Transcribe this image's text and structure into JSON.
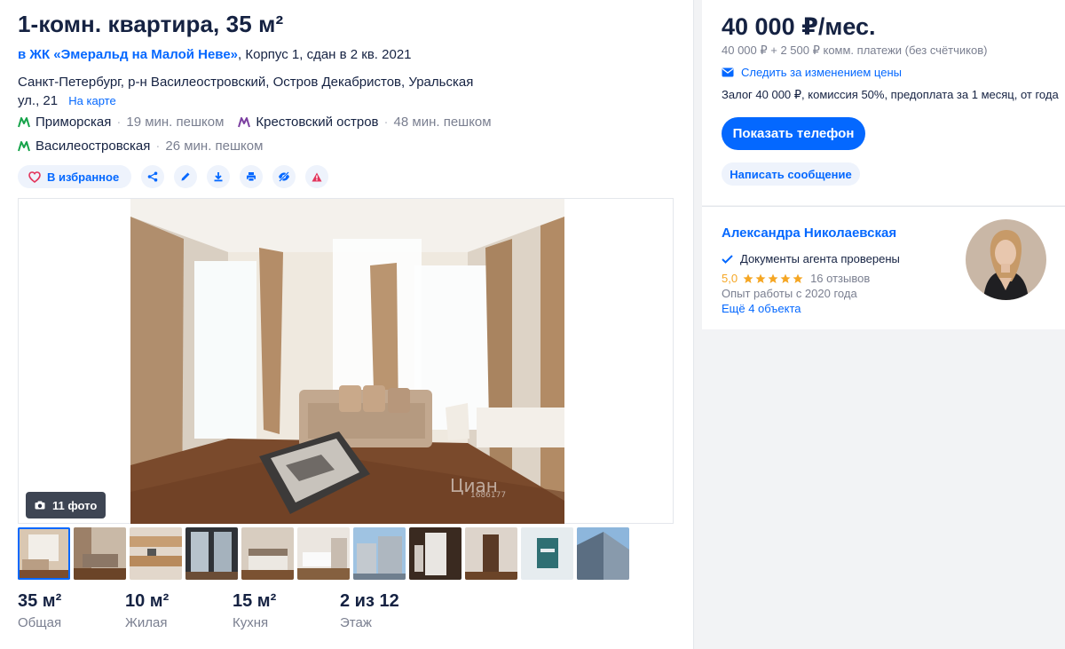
{
  "listing": {
    "title": "1-комн. квартира, 35 м²",
    "complex_link": "в ЖК «Эмеральд на Малой Неве»",
    "complex_rest": ", Корпус 1, сдан в 2 кв. 2021",
    "address": "Санкт-Петербург, р-н Василеостровский, Остров Декабристов, Уральская ул., 21",
    "map_link": "На карте",
    "metro": [
      {
        "name": "Приморская",
        "distance": "19 мин. пешком",
        "color": "#16a34a"
      },
      {
        "name": "Крестовский остров",
        "distance": "48 мин. пешком",
        "color": "#7b3fa0"
      },
      {
        "name": "Василеостровская",
        "distance": "26 мин. пешком",
        "color": "#16a34a"
      }
    ]
  },
  "actions": {
    "favorite": "В избранное",
    "icons": [
      "share-icon",
      "edit-icon",
      "download-icon",
      "print-icon",
      "hide-icon",
      "complain-icon"
    ]
  },
  "gallery": {
    "photo_count": "11 фото",
    "watermark": "Циан",
    "watermark_id": "1686177"
  },
  "specs": [
    {
      "value": "35 м²",
      "label": "Общая"
    },
    {
      "value": "10 м²",
      "label": "Жилая"
    },
    {
      "value": "15 м²",
      "label": "Кухня"
    },
    {
      "value": "2 из 12",
      "label": "Этаж"
    }
  ],
  "price_card": {
    "price": "40 000 ₽/мес.",
    "price_details": "40 000 ₽ + 2 500 ₽ комм. платежи (без счётчиков)",
    "watch_price": "Следить за изменением цены",
    "deposit": "Залог 40 000 ₽, комиссия 50%, предоплата за 1 месяц, от года",
    "phone_button": "Показать телефон",
    "message_button": "Написать сообщение"
  },
  "agent": {
    "name": "Александра Николаевская",
    "verified": "Документы агента проверены",
    "rating": "5,0",
    "stars": 5,
    "reviews": "16 отзывов",
    "experience": "Опыт работы с 2020 года",
    "more_objects": "Ещё 4 объекта"
  },
  "colors": {
    "accent": "#0468ff",
    "text": "#152242",
    "muted": "#7a7f90",
    "star": "#f5a623"
  }
}
